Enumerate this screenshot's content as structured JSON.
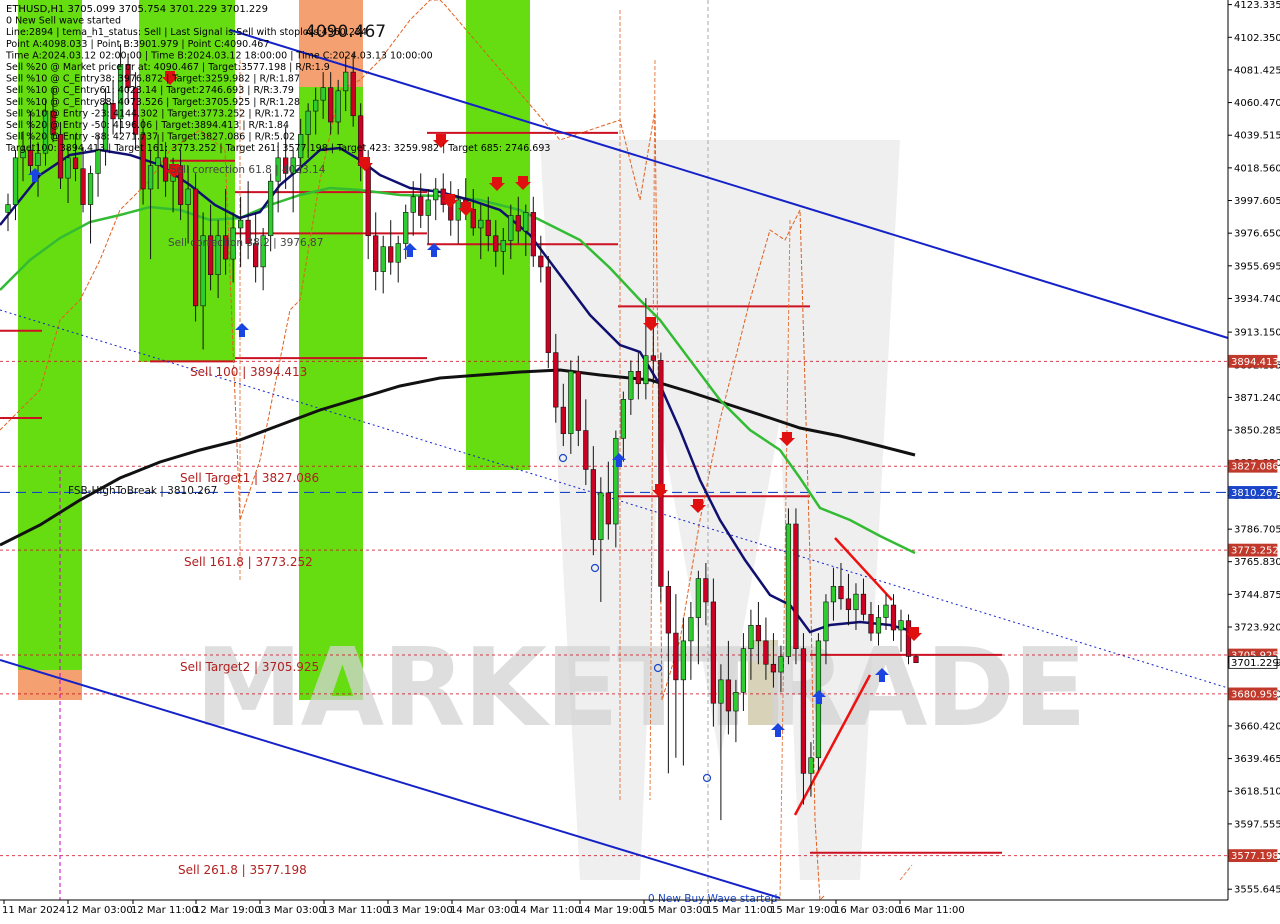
{
  "colors": {
    "bull": "#2ecc2e",
    "bear": "#cc0022",
    "green_zone": "#66dd11",
    "orange_zone": "#f4a070",
    "blue_line": "#1522c8",
    "navy_ma": "#101070",
    "green_ma": "#33bb33",
    "black_ma": "#111111",
    "red_level": "#cc1122",
    "orange_dash": "#e06020",
    "tag_red": "#c0392b",
    "tag_blue": "#1a45c8"
  },
  "header": {
    "lines": [
      "ETHUSD,H1  3705.099 3705.754 3701.229 3701.229",
      "0 New Sell wave started",
      "Line:2894 | tema_h1_status: Sell | Last Signal is:Sell with stoploss:4360.234",
      "Point A:4098.033 | Point B:3901.979 | Point C:4090.467",
      "Time A:2024.03.12 02:00:00 | Time B:2024.03.12 18:00:00 | Time C:2024.03.13 10:00:00",
      "Sell %20 @ Market price or at: 4090.467 | Target:3577.198 | R/R:1.9",
      "Sell %10 @ C_Entry38: 3976.872 | Target:3259.982 | R/R:1.87",
      "Sell %10 @ C_Entry61: 4023.14 | Target:2746.693 | R/R:3.79",
      "Sell %10 @ C_Entry88: 4073.526 | Target:3705.925 | R/R:1.28",
      "Sell %10 @ Entry -23: 4144.302 | Target:3773.252 | R/R:1.72",
      "Sell %20 @ Entry -50: 4196.06 | Target:3894.413 | R/R:1.84",
      "Sell %20 @ Entry -88: 4271.737 | Target:3827.086 | R/R:5.02",
      "Target100: 3894.413 | Target 161: 3773.252 | Target 261: 3577.198 | Target 423: 3259.982 | Target 685: 2746.693"
    ]
  },
  "chart_data": {
    "type": "candlestick",
    "symbol": "ETHUSD,H1",
    "ohlc_header": "3705.099 3705.754 3701.229 3701.229",
    "y_axis": {
      "range": [
        3550,
        4125
      ],
      "ticks": [
        "4123.335",
        "4102.350",
        "4081.425",
        "4060.470",
        "4039.515",
        "4018.560",
        "3997.605",
        "3976.650",
        "3955.695",
        "3934.740",
        "3913.150",
        "3892.195",
        "3871.240",
        "3850.285",
        "3829.330",
        "3808.375",
        "3786.705",
        "3765.830",
        "3744.875",
        "3723.920",
        "3701.229",
        "3681.010",
        "3660.420",
        "3639.465",
        "3618.510",
        "3597.555",
        "3576.600",
        "3555.645"
      ]
    },
    "x_axis": {
      "ticks": [
        "11 Mar 2024",
        "12 Mar 03:00",
        "12 Mar 11:00",
        "12 Mar 19:00",
        "13 Mar 03:00",
        "13 Mar 11:00",
        "13 Mar 19:00",
        "14 Mar 03:00",
        "14 Mar 11:00",
        "14 Mar 19:00",
        "15 Mar 03:00",
        "15 Mar 11:00",
        "15 Mar 19:00",
        "16 Mar 03:00",
        "16 Mar 11:00"
      ]
    },
    "price_tags": [
      {
        "value": 3894.413,
        "label": "3894.413",
        "color": "red"
      },
      {
        "value": 3827.086,
        "label": "3827.086",
        "color": "red"
      },
      {
        "value": 3810.267,
        "label": "3810.267",
        "color": "blue"
      },
      {
        "value": 3773.252,
        "label": "3773.252",
        "color": "red"
      },
      {
        "value": 3705.925,
        "label": "3705.925",
        "color": "red"
      },
      {
        "value": 3701.229,
        "label": "3701.229",
        "color": "black"
      },
      {
        "value": 3680.959,
        "label": "3680.959",
        "color": "red"
      },
      {
        "value": 3577.198,
        "label": "3577.198",
        "color": "red"
      }
    ],
    "level_labels": [
      {
        "text": "Sell 100 | 3894.413",
        "value": 3894.413
      },
      {
        "text": "Sell Target1 | 3827.086",
        "value": 3827.086
      },
      {
        "text": "FSB-HighToBreak | 3810.267",
        "value": 3810.267
      },
      {
        "text": "Sell 161.8 | 3773.252",
        "value": 3773.252
      },
      {
        "text": "Sell Target2 | 3705.925",
        "value": 3705.925
      },
      {
        "text": "Sell 261.8 | 3577.198",
        "value": 3577.198
      },
      {
        "text": "Sell correction 61.8 | 4023.14",
        "value": 4023.14
      },
      {
        "text": "Sell correction 38.2 | 3976.87",
        "value": 3976.87
      },
      {
        "text": "4090.467",
        "value": 4090.467
      },
      {
        "text": "0 New Buy Wave started",
        "value": 3553
      }
    ],
    "candles": [
      {
        "o": 3990,
        "h": 4002,
        "l": 3978,
        "c": 3995
      },
      {
        "o": 3995,
        "h": 4030,
        "l": 3985,
        "c": 4025
      },
      {
        "o": 4025,
        "h": 4042,
        "l": 4010,
        "c": 4030
      },
      {
        "o": 4030,
        "h": 4055,
        "l": 4015,
        "c": 4020
      },
      {
        "o": 4020,
        "h": 4035,
        "l": 4000,
        "c": 4028
      },
      {
        "o": 4028,
        "h": 4062,
        "l": 4020,
        "c": 4055
      },
      {
        "o": 4055,
        "h": 4070,
        "l": 4035,
        "c": 4040
      },
      {
        "o": 4040,
        "h": 4048,
        "l": 4005,
        "c": 4012
      },
      {
        "o": 4012,
        "h": 4032,
        "l": 3996,
        "c": 4025
      },
      {
        "o": 4025,
        "h": 4040,
        "l": 4010,
        "c": 4018
      },
      {
        "o": 4018,
        "h": 4032,
        "l": 3990,
        "c": 3995
      },
      {
        "o": 3995,
        "h": 4020,
        "l": 3970,
        "c": 4015
      },
      {
        "o": 4015,
        "h": 4040,
        "l": 4000,
        "c": 4030
      },
      {
        "o": 4030,
        "h": 4070,
        "l": 4020,
        "c": 4060
      },
      {
        "o": 4060,
        "h": 4075,
        "l": 4040,
        "c": 4050
      },
      {
        "o": 4050,
        "h": 4098,
        "l": 4040,
        "c": 4085
      },
      {
        "o": 4085,
        "h": 4092,
        "l": 4060,
        "c": 4070
      },
      {
        "o": 4070,
        "h": 4080,
        "l": 4030,
        "c": 4040
      },
      {
        "o": 4040,
        "h": 4050,
        "l": 3995,
        "c": 4005
      },
      {
        "o": 4005,
        "h": 4030,
        "l": 3960,
        "c": 4020
      },
      {
        "o": 4020,
        "h": 4040,
        "l": 4005,
        "c": 4025
      },
      {
        "o": 4025,
        "h": 4035,
        "l": 4000,
        "c": 4010
      },
      {
        "o": 4010,
        "h": 4025,
        "l": 3990,
        "c": 4020
      },
      {
        "o": 4020,
        "h": 4030,
        "l": 3985,
        "c": 3995
      },
      {
        "o": 3995,
        "h": 4020,
        "l": 3970,
        "c": 4005
      },
      {
        "o": 4005,
        "h": 4015,
        "l": 3920,
        "c": 3930
      },
      {
        "o": 3930,
        "h": 3990,
        "l": 3902,
        "c": 3975
      },
      {
        "o": 3975,
        "h": 3995,
        "l": 3940,
        "c": 3950
      },
      {
        "o": 3950,
        "h": 3985,
        "l": 3935,
        "c": 3975
      },
      {
        "o": 3975,
        "h": 4005,
        "l": 3950,
        "c": 3960
      },
      {
        "o": 3960,
        "h": 3990,
        "l": 3945,
        "c": 3980
      },
      {
        "o": 3980,
        "h": 4000,
        "l": 3955,
        "c": 3985
      },
      {
        "o": 3985,
        "h": 4010,
        "l": 3960,
        "c": 3970
      },
      {
        "o": 3970,
        "h": 3990,
        "l": 3945,
        "c": 3955
      },
      {
        "o": 3955,
        "h": 3980,
        "l": 3940,
        "c": 3975
      },
      {
        "o": 3975,
        "h": 4015,
        "l": 3965,
        "c": 4010
      },
      {
        "o": 4010,
        "h": 4035,
        "l": 3990,
        "c": 4025
      },
      {
        "o": 4025,
        "h": 4045,
        "l": 4005,
        "c": 4015
      },
      {
        "o": 4015,
        "h": 4030,
        "l": 3990,
        "c": 4025
      },
      {
        "o": 4025,
        "h": 4050,
        "l": 4015,
        "c": 4040
      },
      {
        "o": 4040,
        "h": 4060,
        "l": 4025,
        "c": 4055
      },
      {
        "o": 4055,
        "h": 4070,
        "l": 4040,
        "c": 4062
      },
      {
        "o": 4062,
        "h": 4080,
        "l": 4050,
        "c": 4070
      },
      {
        "o": 4070,
        "h": 4080,
        "l": 4040,
        "c": 4048
      },
      {
        "o": 4048,
        "h": 4075,
        "l": 4040,
        "c": 4068
      },
      {
        "o": 4068,
        "h": 4090,
        "l": 4055,
        "c": 4080
      },
      {
        "o": 4080,
        "h": 4092,
        "l": 4045,
        "c": 4052
      },
      {
        "o": 4052,
        "h": 4060,
        "l": 4010,
        "c": 4020
      },
      {
        "o": 4020,
        "h": 4030,
        "l": 3960,
        "c": 3975
      },
      {
        "o": 3975,
        "h": 3990,
        "l": 3940,
        "c": 3952
      },
      {
        "o": 3952,
        "h": 3975,
        "l": 3938,
        "c": 3968
      },
      {
        "o": 3968,
        "h": 3985,
        "l": 3950,
        "c": 3958
      },
      {
        "o": 3958,
        "h": 3975,
        "l": 3945,
        "c": 3970
      },
      {
        "o": 3970,
        "h": 3995,
        "l": 3960,
        "c": 3990
      },
      {
        "o": 3990,
        "h": 4010,
        "l": 3975,
        "c": 4000
      },
      {
        "o": 4000,
        "h": 4015,
        "l": 3980,
        "c": 3988
      },
      {
        "o": 3988,
        "h": 4005,
        "l": 3970,
        "c": 3998
      },
      {
        "o": 3998,
        "h": 4012,
        "l": 3985,
        "c": 4005
      },
      {
        "o": 4005,
        "h": 4015,
        "l": 3990,
        "c": 3995
      },
      {
        "o": 3995,
        "h": 4010,
        "l": 3975,
        "c": 3985
      },
      {
        "o": 3985,
        "h": 4005,
        "l": 3970,
        "c": 3998
      },
      {
        "o": 3998,
        "h": 4012,
        "l": 3985,
        "c": 3992
      },
      {
        "o": 3992,
        "h": 4005,
        "l": 3975,
        "c": 3980
      },
      {
        "o": 3980,
        "h": 3995,
        "l": 3960,
        "c": 3985
      },
      {
        "o": 3985,
        "h": 4000,
        "l": 3965,
        "c": 3975
      },
      {
        "o": 3975,
        "h": 3985,
        "l": 3955,
        "c": 3965
      },
      {
        "o": 3965,
        "h": 3980,
        "l": 3950,
        "c": 3972
      },
      {
        "o": 3972,
        "h": 3995,
        "l": 3960,
        "c": 3988
      },
      {
        "o": 3988,
        "h": 4000,
        "l": 3970,
        "c": 3978
      },
      {
        "o": 3978,
        "h": 3995,
        "l": 3962,
        "c": 3990
      },
      {
        "o": 3990,
        "h": 4000,
        "l": 3955,
        "c": 3962
      },
      {
        "o": 3962,
        "h": 3975,
        "l": 3945,
        "c": 3955
      },
      {
        "o": 3955,
        "h": 3962,
        "l": 3890,
        "c": 3900
      },
      {
        "o": 3900,
        "h": 3912,
        "l": 3855,
        "c": 3865
      },
      {
        "o": 3865,
        "h": 3880,
        "l": 3840,
        "c": 3848
      },
      {
        "o": 3848,
        "h": 3895,
        "l": 3835,
        "c": 3888
      },
      {
        "o": 3888,
        "h": 3898,
        "l": 3840,
        "c": 3850
      },
      {
        "o": 3850,
        "h": 3870,
        "l": 3815,
        "c": 3825
      },
      {
        "o": 3825,
        "h": 3840,
        "l": 3770,
        "c": 3780
      },
      {
        "o": 3780,
        "h": 3820,
        "l": 3740,
        "c": 3810
      },
      {
        "o": 3810,
        "h": 3830,
        "l": 3780,
        "c": 3790
      },
      {
        "o": 3790,
        "h": 3850,
        "l": 3775,
        "c": 3845
      },
      {
        "o": 3845,
        "h": 3875,
        "l": 3830,
        "c": 3870
      },
      {
        "o": 3870,
        "h": 3895,
        "l": 3860,
        "c": 3888
      },
      {
        "o": 3888,
        "h": 3900,
        "l": 3870,
        "c": 3880
      },
      {
        "o": 3880,
        "h": 3935,
        "l": 3870,
        "c": 3898
      },
      {
        "o": 3898,
        "h": 3918,
        "l": 3880,
        "c": 3895
      },
      {
        "o": 3895,
        "h": 3900,
        "l": 3740,
        "c": 3750
      },
      {
        "o": 3750,
        "h": 3760,
        "l": 3630,
        "c": 3720
      },
      {
        "o": 3720,
        "h": 3745,
        "l": 3640,
        "c": 3690
      },
      {
        "o": 3690,
        "h": 3730,
        "l": 3635,
        "c": 3715
      },
      {
        "o": 3715,
        "h": 3740,
        "l": 3690,
        "c": 3730
      },
      {
        "o": 3730,
        "h": 3760,
        "l": 3700,
        "c": 3755
      },
      {
        "o": 3755,
        "h": 3765,
        "l": 3725,
        "c": 3740
      },
      {
        "o": 3740,
        "h": 3755,
        "l": 3660,
        "c": 3675
      },
      {
        "o": 3675,
        "h": 3700,
        "l": 3600,
        "c": 3690
      },
      {
        "o": 3690,
        "h": 3715,
        "l": 3655,
        "c": 3670
      },
      {
        "o": 3670,
        "h": 3690,
        "l": 3650,
        "c": 3682
      },
      {
        "o": 3682,
        "h": 3720,
        "l": 3670,
        "c": 3710
      },
      {
        "o": 3710,
        "h": 3735,
        "l": 3690,
        "c": 3725
      },
      {
        "o": 3725,
        "h": 3740,
        "l": 3700,
        "c": 3715
      },
      {
        "o": 3715,
        "h": 3730,
        "l": 3690,
        "c": 3700
      },
      {
        "o": 3700,
        "h": 3720,
        "l": 3685,
        "c": 3695
      },
      {
        "o": 3695,
        "h": 3712,
        "l": 3682,
        "c": 3705
      },
      {
        "o": 3705,
        "h": 3800,
        "l": 3700,
        "c": 3790
      },
      {
        "o": 3790,
        "h": 3800,
        "l": 3700,
        "c": 3710
      },
      {
        "o": 3710,
        "h": 3720,
        "l": 3610,
        "c": 3630
      },
      {
        "o": 3630,
        "h": 3650,
        "l": 3615,
        "c": 3640
      },
      {
        "o": 3640,
        "h": 3720,
        "l": 3632,
        "c": 3715
      },
      {
        "o": 3715,
        "h": 3745,
        "l": 3700,
        "c": 3740
      },
      {
        "o": 3740,
        "h": 3762,
        "l": 3728,
        "c": 3750
      },
      {
        "o": 3750,
        "h": 3765,
        "l": 3735,
        "c": 3742
      },
      {
        "o": 3742,
        "h": 3758,
        "l": 3725,
        "c": 3735
      },
      {
        "o": 3735,
        "h": 3752,
        "l": 3722,
        "c": 3745
      },
      {
        "o": 3745,
        "h": 3755,
        "l": 3728,
        "c": 3732
      },
      {
        "o": 3732,
        "h": 3740,
        "l": 3715,
        "c": 3720
      },
      {
        "o": 3720,
        "h": 3738,
        "l": 3712,
        "c": 3730
      },
      {
        "o": 3730,
        "h": 3745,
        "l": 3722,
        "c": 3738
      },
      {
        "o": 3738,
        "h": 3745,
        "l": 3715,
        "c": 3722
      },
      {
        "o": 3722,
        "h": 3735,
        "l": 3708,
        "c": 3728
      },
      {
        "o": 3728,
        "h": 3732,
        "l": 3700,
        "c": 3705
      },
      {
        "o": 3705,
        "h": 3706,
        "l": 3701,
        "c": 3701
      }
    ],
    "series": [
      {
        "name": "",
        "values": []
      }
    ]
  },
  "watermark": "MARKETTRADE"
}
